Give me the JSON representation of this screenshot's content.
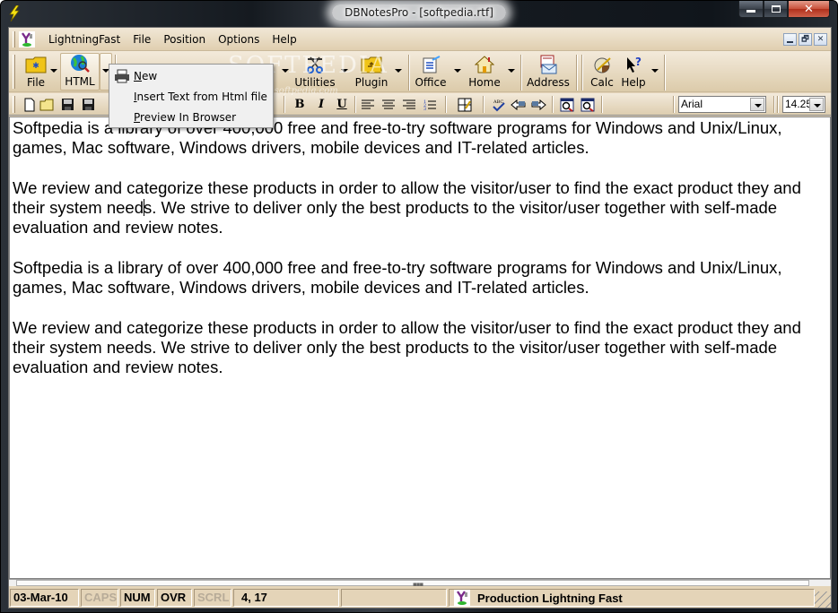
{
  "window": {
    "title": "DBNotesPro - [softpedia.rtf]",
    "caption_buttons": {
      "minimize": "minimize",
      "maximize": "maximize",
      "close": "close"
    }
  },
  "menubar": {
    "items": [
      "LightningFast",
      "File",
      "Position",
      "Options",
      "Help"
    ]
  },
  "toolbar": {
    "buttons": [
      {
        "label": "File",
        "icon": "folder-icon",
        "has_dropdown": true
      },
      {
        "label": "HTML",
        "icon": "globe-search-icon",
        "has_dropdown": true,
        "pressed": true
      },
      {
        "label": "",
        "icon": "notes-edit-icon",
        "has_dropdown": false
      },
      {
        "label": "",
        "icon": "document-icon",
        "has_dropdown": false
      },
      {
        "label": "",
        "icon": "page-icon",
        "has_dropdown": true
      },
      {
        "label": "Utilities",
        "icon": "scissors-tools-icon",
        "has_dropdown": true
      },
      {
        "label": "Plugin",
        "icon": "plugin-folder-icon",
        "has_dropdown": true
      },
      {
        "label": "Office",
        "icon": "office-doc-icon",
        "has_dropdown": true
      },
      {
        "label": "Home",
        "icon": "home-icon",
        "has_dropdown": true
      },
      {
        "label": "Address",
        "icon": "address-book-icon",
        "has_dropdown": false
      },
      {
        "label": "Calc",
        "icon": "calculator-icon",
        "has_dropdown": false
      },
      {
        "label": "Help",
        "icon": "help-pointer-icon",
        "has_dropdown": true
      }
    ]
  },
  "format_toolbar": {
    "bold": "B",
    "italic": "I",
    "underline": "U",
    "font": "Arial",
    "size": "14.25"
  },
  "html_menu": {
    "items": [
      {
        "label": "New",
        "underline_index": 0,
        "icon": "printer-icon"
      },
      {
        "label": "Insert Text from Html file",
        "underline_index": 0
      },
      {
        "label": "Preview In Browser",
        "underline_index": 0
      }
    ]
  },
  "editor": {
    "paragraphs": [
      "Softpedia is a library of over 400,000 free and free-to-try software programs for Windows and Unix/Linux, games, Mac software, Windows drivers, mobile devices and IT-related articles.",
      "We review and categorize these products in order to allow the visitor/user to find the exact product they and their system needs. We strive to deliver only the best products to the visitor/user together with self-made evaluation and review notes.",
      "Softpedia is a library of over 400,000 free and free-to-try software programs for Windows and Unix/Linux, games, Mac software, Windows drivers, mobile devices and IT-related articles.",
      "We review and categorize these products in order to allow the visitor/user to find the exact product they and their system needs. We strive to deliver only the best products to the visitor/user together with self-made evaluation and review notes."
    ],
    "caret_paragraph": 1,
    "caret_after": "We review and categorize these products in order to allow the visitor/user to find the exact product they and their system need"
  },
  "statusbar": {
    "date": "03-Mar-10",
    "caps": "CAPS",
    "num": "NUM",
    "ovr": "OVR",
    "scrl": "SCRL",
    "position": "4, 17",
    "empty1": "",
    "production": "Production Lightning Fast"
  },
  "watermark": {
    "text": "SOFTPEDIA",
    "sub": "www.softpedia.com"
  },
  "colors": {
    "chrome": "#e4d4b8",
    "toolbar_top": "#f3eadb",
    "close_red": "#c8503a"
  }
}
